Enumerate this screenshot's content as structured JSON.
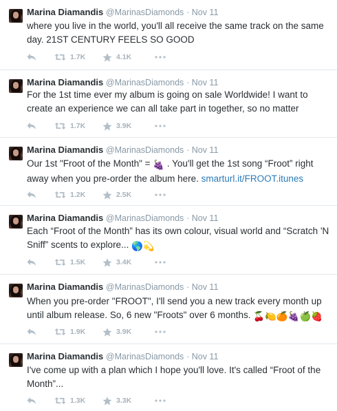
{
  "colors": {
    "muted": "#8899a6",
    "link": "#2b7bb9",
    "text": "#292f33",
    "divider": "#e1e8ed"
  },
  "icons": {
    "reply": "reply-icon",
    "retweet": "retweet-icon",
    "favorite": "star-icon",
    "more": "more-icon"
  },
  "tweets": [
    {
      "name": "Marina Diamandis",
      "handle": "@MarinasDiamonds",
      "sep": "·",
      "time": "Nov 11",
      "text": "where you live in the world, you'll all receive the same track on the same day. 21ST CENTURY FEELS SO GOOD",
      "retweets": "1.7K",
      "favorites": "4.1K"
    },
    {
      "name": "Marina Diamandis",
      "handle": "@MarinasDiamonds",
      "sep": "·",
      "time": "Nov 11",
      "text": "For the 1st time ever my album is going on sale Worldwide! I want to create an experience we can all take part in together, so no matter",
      "retweets": "1.7K",
      "favorites": "3.9K"
    },
    {
      "name": "Marina Diamandis",
      "handle": "@MarinasDiamonds",
      "sep": "·",
      "time": "Nov 11",
      "text_a": "Our 1st \"Froot of the Month\" = ",
      "emoji_a": "🍇",
      "text_b": " . You'll get the 1st song “Froot” right away when you pre-order the album here. ",
      "link": "smarturl.it/FROOT.itunes",
      "retweets": "1.2K",
      "favorites": "2.5K"
    },
    {
      "name": "Marina Diamandis",
      "handle": "@MarinasDiamonds",
      "sep": "·",
      "time": "Nov 11",
      "text": "Each “Froot of the Month” has its own colour, visual world and “Scratch 'N Sniff” scents to explore... ",
      "emoji": "🌎💫",
      "retweets": "1.5K",
      "favorites": "3.4K"
    },
    {
      "name": "Marina Diamandis",
      "handle": "@MarinasDiamonds",
      "sep": "·",
      "time": "Nov 11",
      "text": "When you pre-order \"FROOT\", I'll send you a new track every month up until album release. So, 6 new \"Froots\" over 6 months. ",
      "emoji": "🍒🍋🍊🍇🍏🍓",
      "retweets": "1.9K",
      "favorites": "3.9K"
    },
    {
      "name": "Marina Diamandis",
      "handle": "@MarinasDiamonds",
      "sep": "·",
      "time": "Nov 11",
      "text": "I've come up with a plan which I hope you'll love. It's called “Froot of the Month”...",
      "retweets": "1.3K",
      "favorites": "3.3K"
    }
  ]
}
